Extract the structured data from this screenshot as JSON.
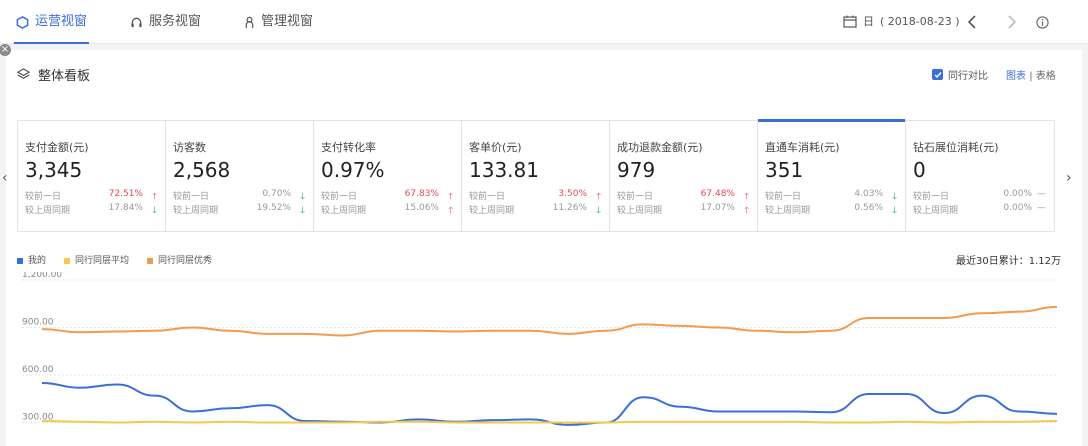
{
  "tabs": [
    {
      "label": "运营视窗",
      "icon": "hexagon-icon",
      "active": true
    },
    {
      "label": "服务视窗",
      "icon": "headset-icon",
      "active": false
    },
    {
      "label": "管理视窗",
      "icon": "user-icon",
      "active": false
    }
  ],
  "date": {
    "prefix": "日",
    "value": "( 2018-08-23 )"
  },
  "panel": {
    "title": "整体看板",
    "compare_label": "同行对比",
    "view_chart": "图表",
    "view_sep": "|",
    "view_table": "表格"
  },
  "colors": {
    "accent": "#3b6fd8",
    "up": "#e8495b",
    "down": "#1ba784",
    "mine": "#3b6fd8",
    "avg": "#f5c94a",
    "top": "#f39a4f"
  },
  "cards": [
    {
      "title": "支付金额(元)",
      "value": "3,345",
      "day_label": "较前一日",
      "day_pct": "72.51%",
      "day_dir": "up",
      "week_label": "较上周同期",
      "week_pct": "17.84%",
      "week_dir": "down"
    },
    {
      "title": "访客数",
      "value": "2,568",
      "day_label": "较前一日",
      "day_pct": "0.70%",
      "day_dir": "down",
      "week_label": "较上周同期",
      "week_pct": "19.52%",
      "week_dir": "down"
    },
    {
      "title": "支付转化率",
      "value": "0.97%",
      "day_label": "较前一日",
      "day_pct": "67.83%",
      "day_dir": "up",
      "week_label": "较上周同期",
      "week_pct": "15.06%",
      "week_dir": "up"
    },
    {
      "title": "客单价(元)",
      "value": "133.81",
      "day_label": "较前一日",
      "day_pct": "3.50%",
      "day_dir": "up",
      "week_label": "较上周同期",
      "week_pct": "11.26%",
      "week_dir": "down"
    },
    {
      "title": "成功退款金额(元)",
      "value": "979",
      "day_label": "较前一日",
      "day_pct": "67.48%",
      "day_dir": "up",
      "week_label": "较上周同期",
      "week_pct": "17.07%",
      "week_dir": "up"
    },
    {
      "title": "直通车消耗(元)",
      "value": "351",
      "day_label": "较前一日",
      "day_pct": "4.03%",
      "day_dir": "down",
      "week_label": "较上周同期",
      "week_pct": "0.56%",
      "week_dir": "down",
      "active": true
    },
    {
      "title": "钻石展位消耗(元)",
      "value": "0",
      "day_label": "较前一日",
      "day_pct": "0.00%",
      "day_dir": "flat",
      "week_label": "较上周同期",
      "week_pct": "0.00%",
      "week_dir": "flat"
    }
  ],
  "legend": [
    {
      "name": "我的",
      "color": "#3b6fd8"
    },
    {
      "name": "同行同层平均",
      "color": "#f5c94a"
    },
    {
      "name": "同行同层优秀",
      "color": "#f39a4f"
    }
  ],
  "total_label": "最近30日累计：1.12万",
  "chart_data": {
    "type": "line",
    "yticks": [
      "1,200.00",
      "900.00",
      "600.00",
      "300.00"
    ],
    "ylim": [
      200,
      1200
    ],
    "series": [
      {
        "name": "我的",
        "values": [
          550,
          520,
          540,
          470,
          370,
          390,
          410,
          310,
          305,
          300,
          320,
          305,
          315,
          320,
          285,
          300,
          460,
          400,
          370,
          370,
          370,
          365,
          480,
          480,
          360,
          470,
          370,
          355
        ]
      },
      {
        "name": "同行同层平均",
        "values": [
          310,
          305,
          300,
          305,
          300,
          305,
          300,
          300,
          300,
          305,
          305,
          300,
          300,
          300,
          300,
          300,
          305,
          305,
          305,
          305,
          305,
          300,
          300,
          305,
          300,
          305,
          305,
          310
        ]
      },
      {
        "name": "同行同层优秀",
        "values": [
          890,
          870,
          875,
          880,
          900,
          880,
          860,
          860,
          850,
          880,
          880,
          875,
          880,
          880,
          860,
          880,
          920,
          910,
          900,
          880,
          870,
          880,
          960,
          960,
          960,
          990,
          1000,
          1030
        ]
      }
    ]
  }
}
